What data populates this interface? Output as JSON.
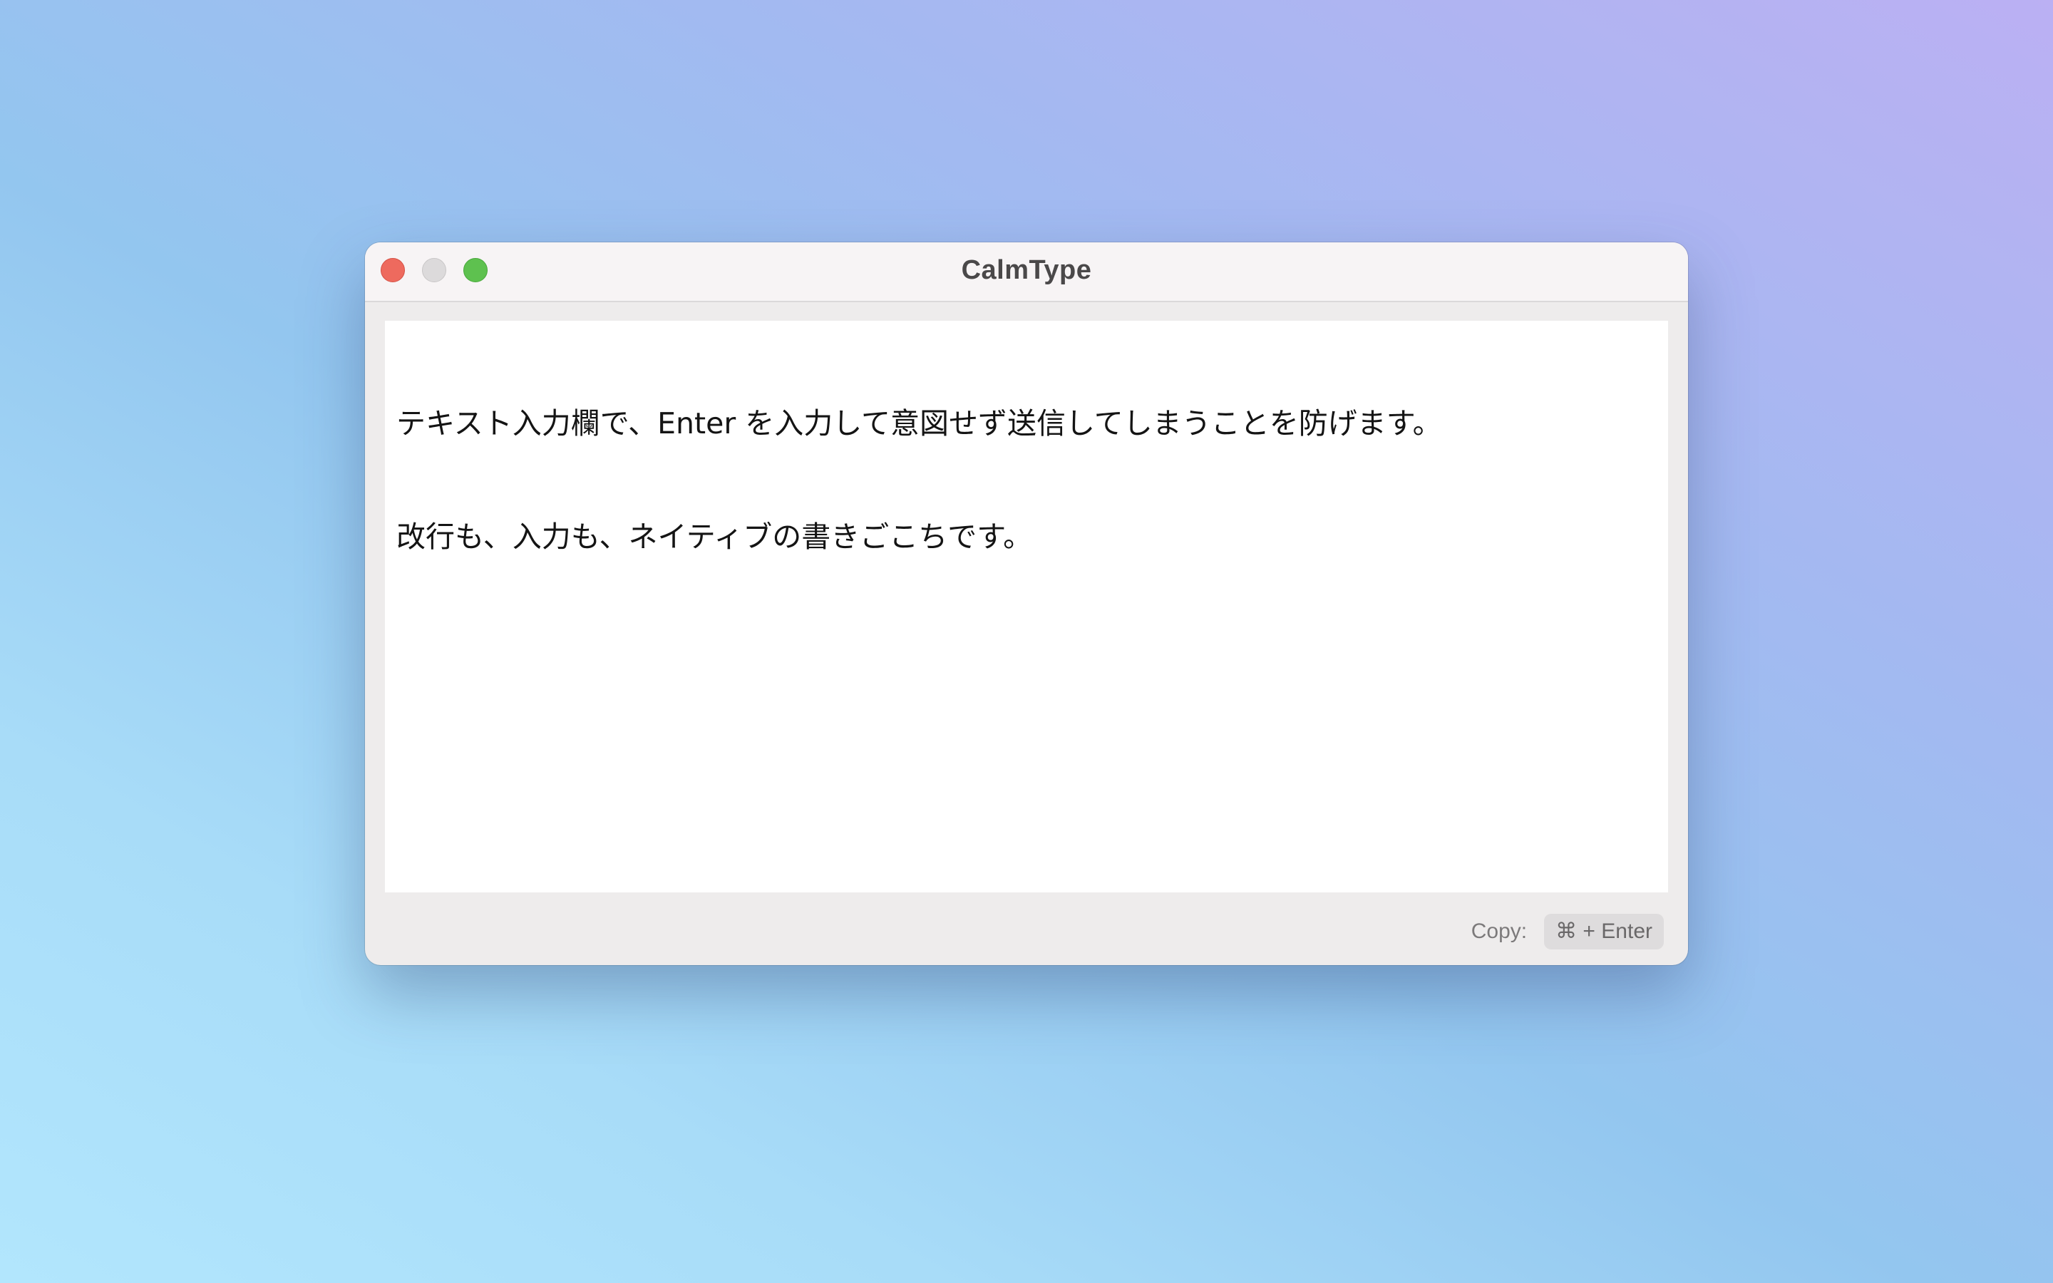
{
  "window": {
    "title": "CalmType"
  },
  "traffic_lights": {
    "close_color": "#ee6a5e",
    "minimize_color": "#dcdadb",
    "zoom_color": "#5ec14f"
  },
  "editor": {
    "lines": [
      "テキスト入力欄で、Enter を入力して意図せず送信してしまうことを防げます。",
      "改行も、入力も、ネイティブの書きごこちです。"
    ]
  },
  "footer": {
    "copy_label": "Copy:",
    "shortcut": "⌘ + Enter"
  }
}
